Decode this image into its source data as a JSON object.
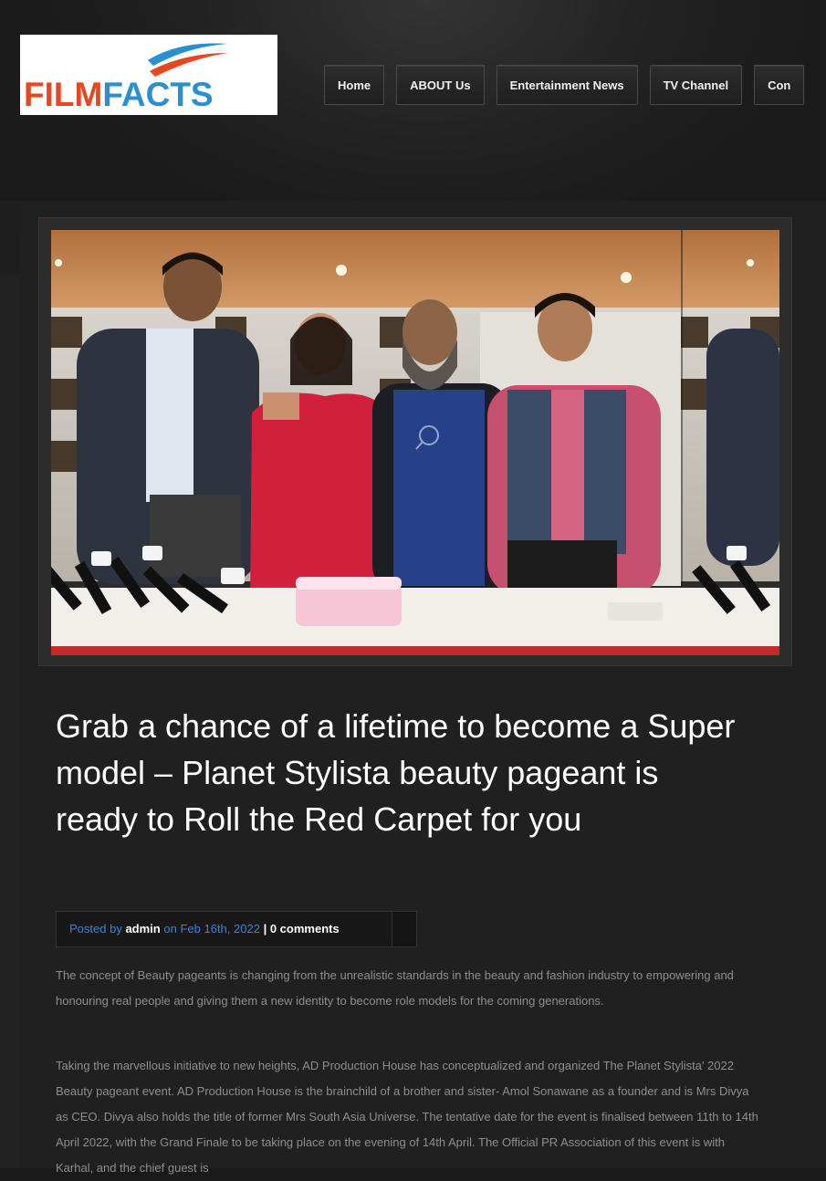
{
  "logo": {
    "part1": "FILM",
    "part2": "FACTS"
  },
  "nav": {
    "items": [
      "Home",
      "ABOUT Us",
      "Entertainment News",
      "TV Channel",
      "Con"
    ]
  },
  "post": {
    "image_icon": "magnifier-icon",
    "title": "Grab a chance of a lifetime to become a Super model – Planet Stylista beauty pageant is ready to Roll the Red Carpet for you",
    "meta": {
      "posted_by": "Posted by",
      "author": "admin",
      "on": "on",
      "date": "Feb 16th, 2022",
      "separator": "|",
      "comments": "0 comments"
    },
    "paragraphs": [
      "The concept of Beauty pageants is changing from the unrealistic standards in the beauty and fashion industry to empowering and honouring real people and giving them a new identity to become role models for the coming generations.",
      "Taking the marvellous initiative to new heights, AD Production House has conceptualized and organized The Planet Stylista' 2022 Beauty pageant event. AD Production House is the brainchild of a brother and sister- Amol Sonawane as a founder and is Mrs Divya as CEO. Divya also holds the title of former Mrs South Asia Universe. The tentative date for the event is finalised between 11th to 14th April 2022, with the Grand Finale to be taking place on the evening of 14th April. The Official PR Association of this event is with Karhal, and the chief guest is"
    ]
  },
  "colors": {
    "background": "#1a1a1a",
    "panel": "#202020",
    "accent_blue": "#3b82d6",
    "logo_red": "#e8461f",
    "logo_blue": "#2a8fd0"
  }
}
